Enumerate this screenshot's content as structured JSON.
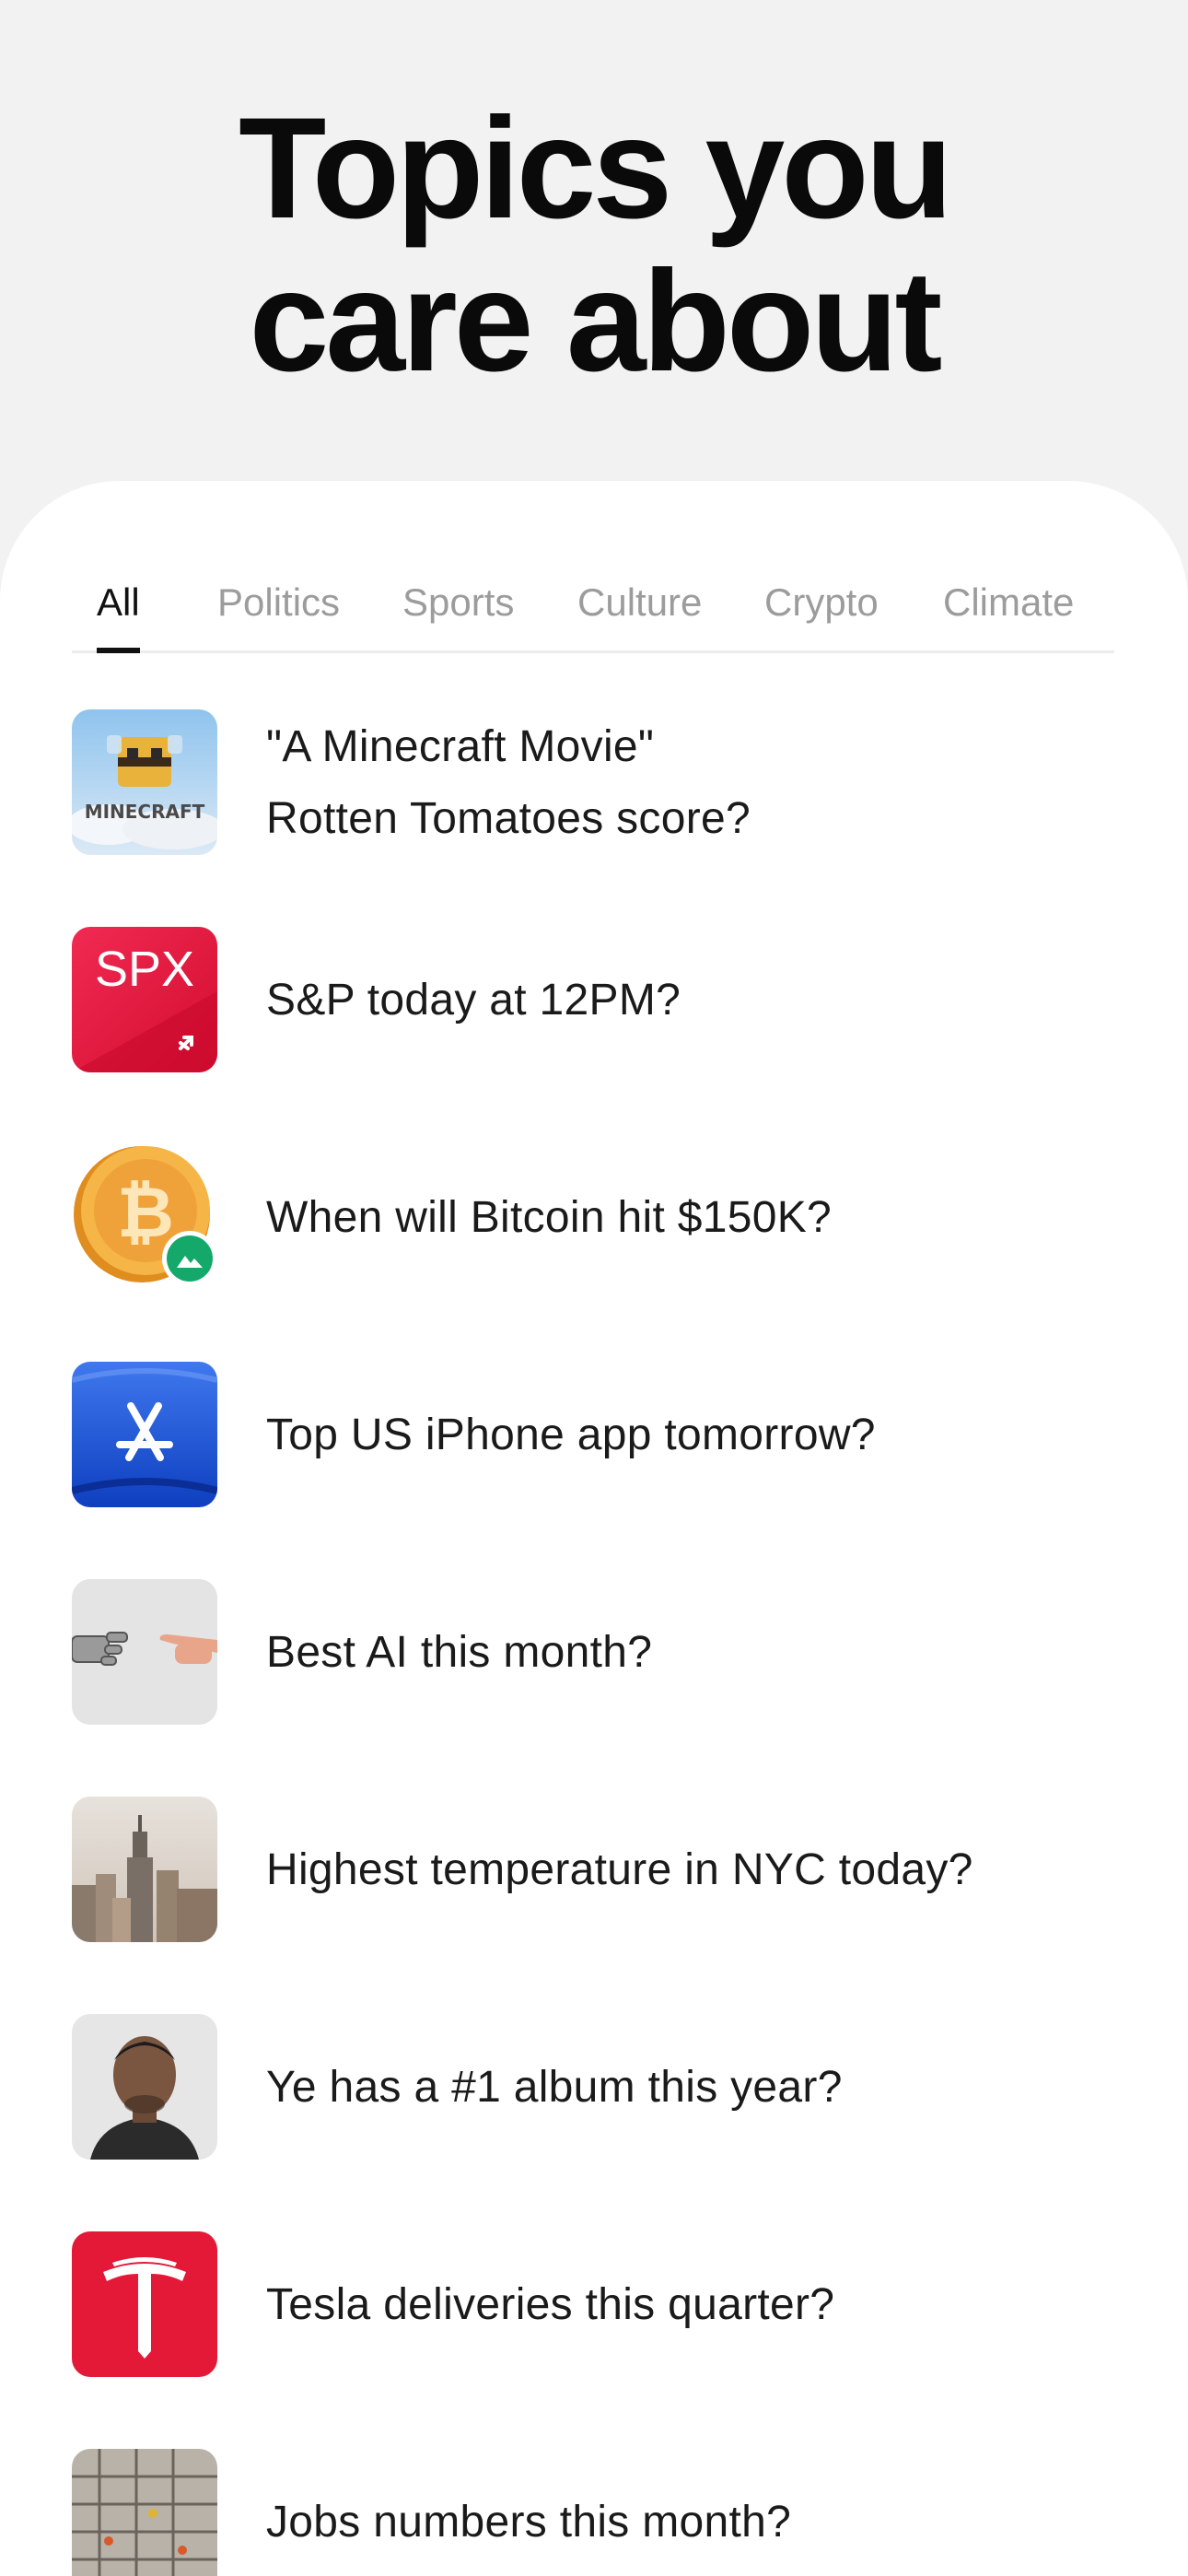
{
  "hero": {
    "title_line1": "Topics you",
    "title_line2": "care about"
  },
  "tabs": [
    {
      "label": "All",
      "active": true
    },
    {
      "label": "Politics",
      "active": false
    },
    {
      "label": "Sports",
      "active": false
    },
    {
      "label": "Culture",
      "active": false
    },
    {
      "label": "Crypto",
      "active": false
    },
    {
      "label": "Climate",
      "active": false
    }
  ],
  "topics": [
    {
      "label_line1": "\"A Minecraft Movie\"",
      "label_line2": "Rotten Tomatoes score?",
      "icon": "minecraft-movie-thumbnail",
      "thumb_text": "MINECRAFT"
    },
    {
      "label_line1": "S&P today at 12PM?",
      "icon": "spx-index-icon",
      "thumb_text": "SPX"
    },
    {
      "label_line1": "When will Bitcoin hit $150K?",
      "icon": "bitcoin-coin-icon",
      "thumb_text": "₿"
    },
    {
      "label_line1": "Top US iPhone app tomorrow?",
      "icon": "app-store-icon"
    },
    {
      "label_line1": "Best AI this month?",
      "icon": "robot-human-hands-icon"
    },
    {
      "label_line1": "Highest temperature in NYC today?",
      "icon": "nyc-skyline-icon"
    },
    {
      "label_line1": "Ye has a #1 album this year?",
      "icon": "ye-portrait-avatar"
    },
    {
      "label_line1": "Tesla deliveries this quarter?",
      "icon": "tesla-logo-icon"
    },
    {
      "label_line1": "Jobs numbers this month?",
      "icon": "construction-site-icon"
    }
  ],
  "colors": {
    "background": "#f2f2f2",
    "sheet": "#ffffff",
    "text": "#111111",
    "tab_inactive": "#9c9c9c",
    "spx_red": "#e0143c",
    "tesla_red": "#e31937",
    "bitcoin_orange": "#f0a23a",
    "badge_green": "#14a86a",
    "appstore_blue": "#1a4fd0"
  }
}
